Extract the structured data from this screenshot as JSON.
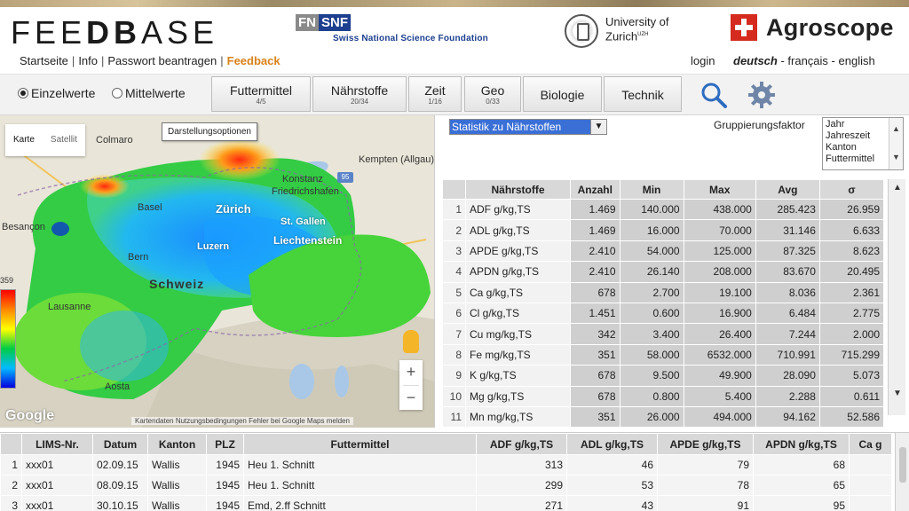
{
  "header": {
    "logo_light": "FEE",
    "logo_bold": "DB",
    "logo_tail": "ASE",
    "snf_mark_a": "FN",
    "snf_mark_b": "SNF",
    "snf_text": "Swiss National Science Foundation",
    "uzh_line1": "University of",
    "uzh_line2": "Zurich",
    "uzh_sup": "UZH",
    "agroscope": "Agroscope",
    "nav": [
      {
        "label": "Startseite"
      },
      {
        "label": "Info"
      },
      {
        "label": "Passwort beantragen"
      },
      {
        "label": "Feedback"
      }
    ],
    "login": "login",
    "languages": [
      "deutsch",
      "français",
      "english"
    ],
    "lang_sep": " - "
  },
  "toolbar": {
    "radio_single": "Einzelwerte",
    "radio_mean": "Mittelwerte",
    "tabs": [
      {
        "label": "Futtermittel",
        "count": "4/5"
      },
      {
        "label": "Nährstoffe",
        "count": "20/34"
      },
      {
        "label": "Zeit",
        "count": "1/16"
      },
      {
        "label": "Geo",
        "count": "0/33"
      },
      {
        "label": "Biologie",
        "count": ""
      },
      {
        "label": "Technik",
        "count": ""
      }
    ],
    "icons": [
      "search-icon",
      "gear-icon"
    ]
  },
  "map": {
    "type_karte": "Karte",
    "type_satellit": "Satellit",
    "tooltip": "Darstellungsoptionen",
    "legend_max": "359",
    "labels": [
      "Colmaro",
      "Kempten (Allgau)",
      "Konstanz",
      "Friedrichshafen",
      "Basel",
      "Zürich",
      "St. Gallen",
      "Liechtenstein",
      "Besançon",
      "Luzern",
      "Bern",
      "Schweiz",
      "Lausanne",
      "Aosta"
    ],
    "road_badge": "95",
    "google": "Google",
    "footer": "Kartendaten   Nutzungsbedingungen   Fehler bei Google Maps melden",
    "colors": {
      "land": "#e7e3d6",
      "lake": "#a9c8e8",
      "heat_green": "#22cc33",
      "heat_blue": "#22a8ff",
      "heat_red": "#ff3b1f"
    }
  },
  "stats": {
    "select_value": "Statistik zu Nährstoffen",
    "grouping_label": "Gruppierungsfaktor",
    "grouping_options": [
      "Jahr",
      "Jahreszeit",
      "Kanton",
      "Futtermittel"
    ],
    "columns": [
      "",
      "Nährstoffe",
      "Anzahl",
      "Min",
      "Max",
      "Avg",
      "σ"
    ],
    "rows": [
      [
        "1",
        "ADF g/kg,TS",
        "1.469",
        "140.000",
        "438.000",
        "285.423",
        "26.959"
      ],
      [
        "2",
        "ADL g/kg,TS",
        "1.469",
        "16.000",
        "70.000",
        "31.146",
        "6.633"
      ],
      [
        "3",
        "APDE g/kg,TS",
        "2.410",
        "54.000",
        "125.000",
        "87.325",
        "8.623"
      ],
      [
        "4",
        "APDN g/kg,TS",
        "2.410",
        "26.140",
        "208.000",
        "83.670",
        "20.495"
      ],
      [
        "5",
        "Ca g/kg,TS",
        "678",
        "2.700",
        "19.100",
        "8.036",
        "2.361"
      ],
      [
        "6",
        "Cl g/kg,TS",
        "1.451",
        "0.600",
        "16.900",
        "6.484",
        "2.775"
      ],
      [
        "7",
        "Cu mg/kg,TS",
        "342",
        "3.400",
        "26.400",
        "7.244",
        "2.000"
      ],
      [
        "8",
        "Fe mg/kg,TS",
        "351",
        "58.000",
        "6532.000",
        "710.991",
        "715.299"
      ],
      [
        "9",
        "K g/kg,TS",
        "678",
        "9.500",
        "49.900",
        "28.090",
        "5.073"
      ],
      [
        "10",
        "Mg g/kg,TS",
        "678",
        "0.800",
        "5.400",
        "2.288",
        "0.611"
      ],
      [
        "11",
        "Mn mg/kg,TS",
        "351",
        "26.000",
        "494.000",
        "94.162",
        "52.586"
      ]
    ]
  },
  "data_table": {
    "columns": [
      "",
      "LIMS-Nr.",
      "Datum",
      "Kanton",
      "PLZ",
      "Futtermittel",
      "ADF g/kg,TS",
      "ADL g/kg,TS",
      "APDE g/kg,TS",
      "APDN g/kg,TS",
      "Ca g"
    ],
    "rows": [
      [
        "1",
        "xxx01",
        "02.09.15",
        "Wallis",
        "1945",
        "Heu 1. Schnitt",
        "313",
        "46",
        "79",
        "68",
        ""
      ],
      [
        "2",
        "xxx01",
        "08.09.15",
        "Wallis",
        "1945",
        "Heu 1. Schnitt",
        "299",
        "53",
        "78",
        "65",
        ""
      ],
      [
        "3",
        "xxx01",
        "30.10.15",
        "Wallis",
        "1945",
        "Emd, 2.ff Schnitt",
        "271",
        "43",
        "91",
        "95",
        ""
      ]
    ]
  }
}
